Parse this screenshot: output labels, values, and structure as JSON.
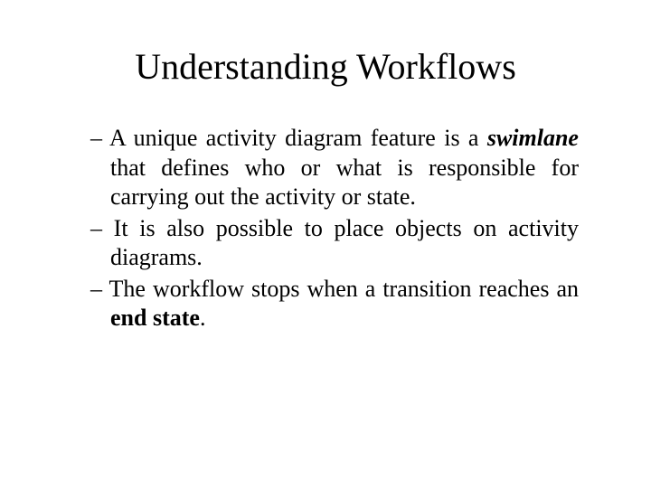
{
  "title": "Understanding Workflows",
  "bullets": [
    {
      "dash": "– ",
      "pre": "A unique activity diagram feature is a ",
      "em": "swimlane",
      "post": " that defines who or what is responsible for carrying out the activity or state."
    },
    {
      "dash": "– ",
      "pre": "It is also possible to place objects on activity diagrams.",
      "em": "",
      "post": ""
    },
    {
      "dash": "– ",
      "pre": "The workflow stops when a transition reaches an ",
      "em2": "end state",
      "post": "."
    }
  ]
}
